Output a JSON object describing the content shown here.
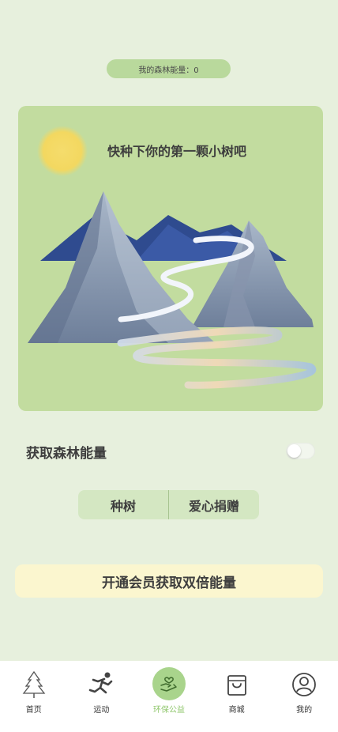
{
  "energy": {
    "label": "我的森林能量：0"
  },
  "card": {
    "title": "快种下你的第一颗小树吧"
  },
  "energy_toggle": {
    "label": "获取森林能量",
    "on": false
  },
  "segment": {
    "plant_label": "种树",
    "donate_label": "爱心捐赠"
  },
  "member": {
    "label": "开通会员获取双倍能量"
  },
  "tabbar": {
    "items": [
      {
        "label": "首页",
        "icon": "tree-icon"
      },
      {
        "label": "运动",
        "icon": "runner-icon"
      },
      {
        "label": "环保公益",
        "icon": "hands-heart-icon",
        "active": true
      },
      {
        "label": "商城",
        "icon": "shopping-bag-icon"
      },
      {
        "label": "我的",
        "icon": "user-icon"
      }
    ]
  },
  "colors": {
    "background": "#e7f0dd",
    "card": "#c2dc9f",
    "accent": "#8ec66a",
    "member_bar": "#fbf6cf"
  }
}
